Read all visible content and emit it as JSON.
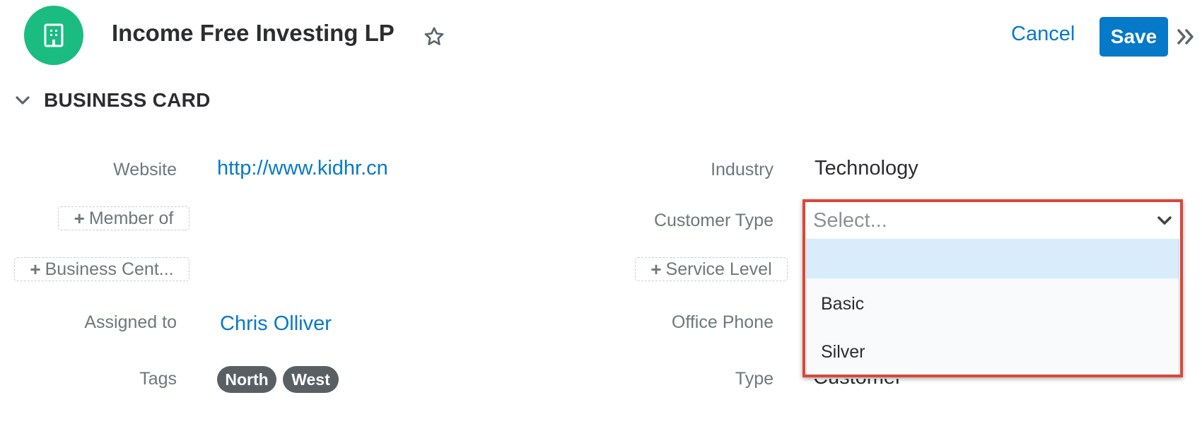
{
  "header": {
    "record_name": "Income Free Investing LP",
    "cancel_label": "Cancel",
    "save_label": "Save",
    "record_icon": "building-icon",
    "favorite_icon": "star-icon",
    "toggle_icon": "double-chevron-right-icon"
  },
  "section": {
    "title": "BUSINESS CARD",
    "collapse_icon": "chevron-down-icon"
  },
  "fields_left": {
    "website_label": "Website",
    "website_value": "http://www.kidhr.cn",
    "member_of_label": "Member of",
    "business_center_label": "Business Cent...",
    "assigned_to_label": "Assigned to",
    "assigned_to_value": "Chris Olliver",
    "tags_label": "Tags",
    "tags": [
      "North",
      "West"
    ]
  },
  "fields_right": {
    "industry_label": "Industry",
    "industry_value": "Technology",
    "customer_type_label": "Customer Type",
    "customer_type_placeholder": "Select...",
    "service_level_label": "Service Level",
    "office_phone_label": "Office Phone",
    "type_label": "Type",
    "type_value": "Customer"
  },
  "dropdown": {
    "options": [
      "",
      "Basic",
      "Silver"
    ],
    "highlighted_index": 0
  },
  "colors": {
    "accent": "#0679c8",
    "record_icon_bg": "#1abc82",
    "highlight_frame": "#d94838",
    "tag_bg": "#595f63",
    "option_highlight": "#d8ecfb"
  }
}
